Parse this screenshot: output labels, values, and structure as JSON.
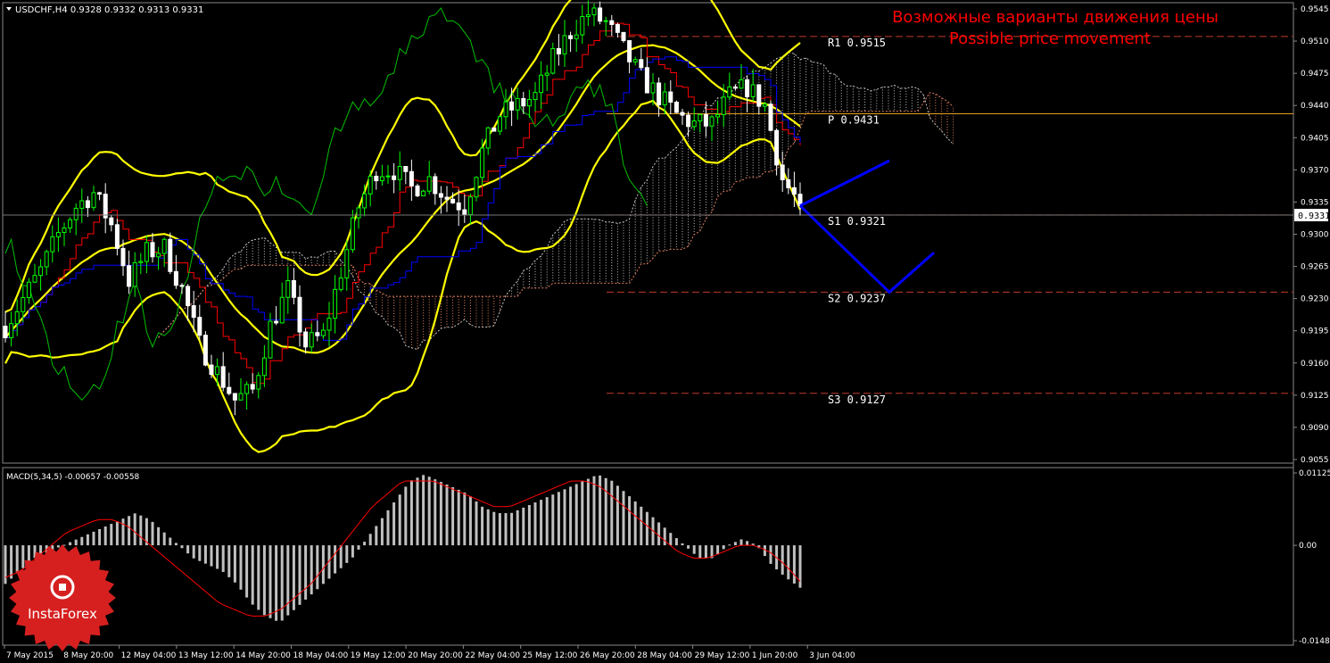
{
  "window": {
    "symbol_header": "USDCHF,H4  0.9328 0.9332 0.9313 0.9331",
    "current_price": "0.9331"
  },
  "annotation": {
    "ru": "Возможные варианты движения цены",
    "en": "Possible price movement"
  },
  "pivot_levels": [
    {
      "label": "R1",
      "value": "0.9515",
      "num": 0.9515,
      "color": "#c0392b"
    },
    {
      "label": "P",
      "value": "0.9431",
      "num": 0.9431,
      "color": "#e0a020"
    },
    {
      "label": "S1",
      "value": "0.9321",
      "num": 0.9321,
      "color": "#c0392b"
    },
    {
      "label": "S2",
      "value": "0.9237",
      "num": 0.9237,
      "color": "#c0392b"
    },
    {
      "label": "S3",
      "value": "0.9127",
      "num": 0.9127,
      "color": "#c0392b"
    }
  ],
  "indicator": {
    "title": "MACD(5,34,5) -0.00657 -0.00558",
    "ticks": [
      "0.01125",
      "0.00",
      "-0.01483"
    ]
  },
  "logo": {
    "text": "InstaForex"
  },
  "colors": {
    "background": "#000000",
    "bull": "#00ff00",
    "bear": "#ffffff",
    "bollinger": "#ffff00",
    "tenkan": "#ff0000",
    "kijun": "#0000ff",
    "chikou": "#00c000",
    "forecast": "#0000ff",
    "macd_hist": "#c0c0c0",
    "macd_signal": "#ff0000",
    "title": "#ff0000"
  },
  "chart_data": {
    "type": "line",
    "instrument": "USDCHF",
    "timeframe": "H4",
    "ylim": [
      0.9055,
      0.9545
    ],
    "y_ticks": [
      "0.9545",
      "0.9510",
      "0.9475",
      "0.9440",
      "0.9405",
      "0.9370",
      "0.9335",
      "0.9300",
      "0.9265",
      "0.9230",
      "0.9195",
      "0.9160",
      "0.9125",
      "0.9090",
      "0.9055"
    ],
    "x_ticks": [
      "7 May 2015",
      "8 May 20:00",
      "12 May 04:00",
      "13 May 12:00",
      "14 May 20:00",
      "18 May 04:00",
      "19 May 12:00",
      "20 May 20:00",
      "22 May 04:00",
      "25 May 12:00",
      "26 May 20:00",
      "28 May 04:00",
      "29 May 12:00",
      "1 Jun 20:00",
      "3 Jun 04:00"
    ],
    "price_path": [
      0.92,
      0.923,
      0.926,
      0.93,
      0.933,
      0.9345,
      0.931,
      0.925,
      0.928,
      0.9285,
      0.924,
      0.918,
      0.915,
      0.912,
      0.913,
      0.92,
      0.924,
      0.918,
      0.919,
      0.926,
      0.933,
      0.937,
      0.937,
      0.935,
      0.936,
      0.934,
      0.933,
      0.939,
      0.943,
      0.944,
      0.945,
      0.949,
      0.952,
      0.954,
      0.953,
      0.95,
      0.947,
      0.945,
      0.943,
      0.942,
      0.942,
      0.945,
      0.946,
      0.944,
      0.936,
      0.9331
    ],
    "forecast_path": [
      {
        "label": "up",
        "points": [
          [
            0.0,
            0.9331
          ],
          [
            1.0,
            0.938
          ]
        ]
      },
      {
        "label": "down",
        "points": [
          [
            0.0,
            0.9331
          ],
          [
            1.0,
            0.9237
          ],
          [
            1.5,
            0.928
          ]
        ]
      }
    ],
    "macd": {
      "hist": [
        -0.006,
        -0.004,
        -0.002,
        -0.001,
        0.0,
        0.001,
        0.002,
        0.003,
        0.004,
        0.005,
        0.004,
        0.002,
        0.0,
        -0.002,
        -0.003,
        -0.004,
        -0.006,
        -0.009,
        -0.011,
        -0.012,
        -0.01,
        -0.008,
        -0.006,
        -0.004,
        -0.002,
        0.001,
        0.004,
        0.007,
        0.01,
        0.011,
        0.01,
        0.009,
        0.008,
        0.006,
        0.005,
        0.005,
        0.006,
        0.007,
        0.008,
        0.009,
        0.01,
        0.011,
        0.01,
        0.008,
        0.006,
        0.004,
        0.002,
        0.0,
        -0.002,
        -0.002,
        0.0,
        0.001,
        0.0,
        -0.003,
        -0.005,
        -0.0066
      ],
      "signal": [
        -0.005,
        -0.004,
        -0.002,
        0.0,
        0.002,
        0.003,
        0.004,
        0.004,
        0.003,
        0.001,
        -0.001,
        -0.003,
        -0.005,
        -0.007,
        -0.009,
        -0.01,
        -0.011,
        -0.011,
        -0.01,
        -0.008,
        -0.006,
        -0.003,
        0.0,
        0.003,
        0.006,
        0.008,
        0.01,
        0.01,
        0.01,
        0.009,
        0.008,
        0.007,
        0.006,
        0.006,
        0.007,
        0.008,
        0.009,
        0.01,
        0.01,
        0.009,
        0.007,
        0.005,
        0.003,
        0.001,
        -0.001,
        -0.002,
        -0.002,
        -0.001,
        0.0,
        0.0,
        -0.001,
        -0.003,
        -0.0056
      ],
      "ylim": [
        -0.01483,
        0.01125
      ]
    }
  }
}
